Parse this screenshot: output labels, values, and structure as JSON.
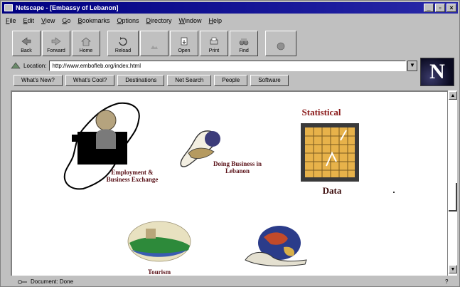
{
  "window": {
    "title": "Netscape - [Embassy of Lebanon]",
    "controls": {
      "minimize": "_",
      "maximize": "▫",
      "close": "×"
    }
  },
  "menu": [
    "File",
    "Edit",
    "View",
    "Go",
    "Bookmarks",
    "Options",
    "Directory",
    "Window",
    "Help"
  ],
  "toolbar": {
    "back": "Back",
    "forward": "Forward",
    "home": "Home",
    "reload": "Reload",
    "images": "",
    "open": "Open",
    "print": "Print",
    "find": "Find",
    "stop": ""
  },
  "location": {
    "label": "Location:",
    "url": "http://www.embofleb.org/index.html"
  },
  "directory_buttons": [
    "What's New?",
    "What's Cool?",
    "Destinations",
    "Net Search",
    "People",
    "Software"
  ],
  "logo": {
    "letter": "N"
  },
  "content": {
    "employment": "Employment & Business Exchange",
    "business": "Doing Business in Lebanon",
    "statistical": "Statistical",
    "data": "Data",
    "tourism": "Tourism"
  },
  "status": {
    "text": "Document: Done",
    "mail_icon": "?"
  },
  "colors": {
    "titlebar": "#000080",
    "chrome": "#c0c0c0",
    "caption": "#5a1218"
  }
}
